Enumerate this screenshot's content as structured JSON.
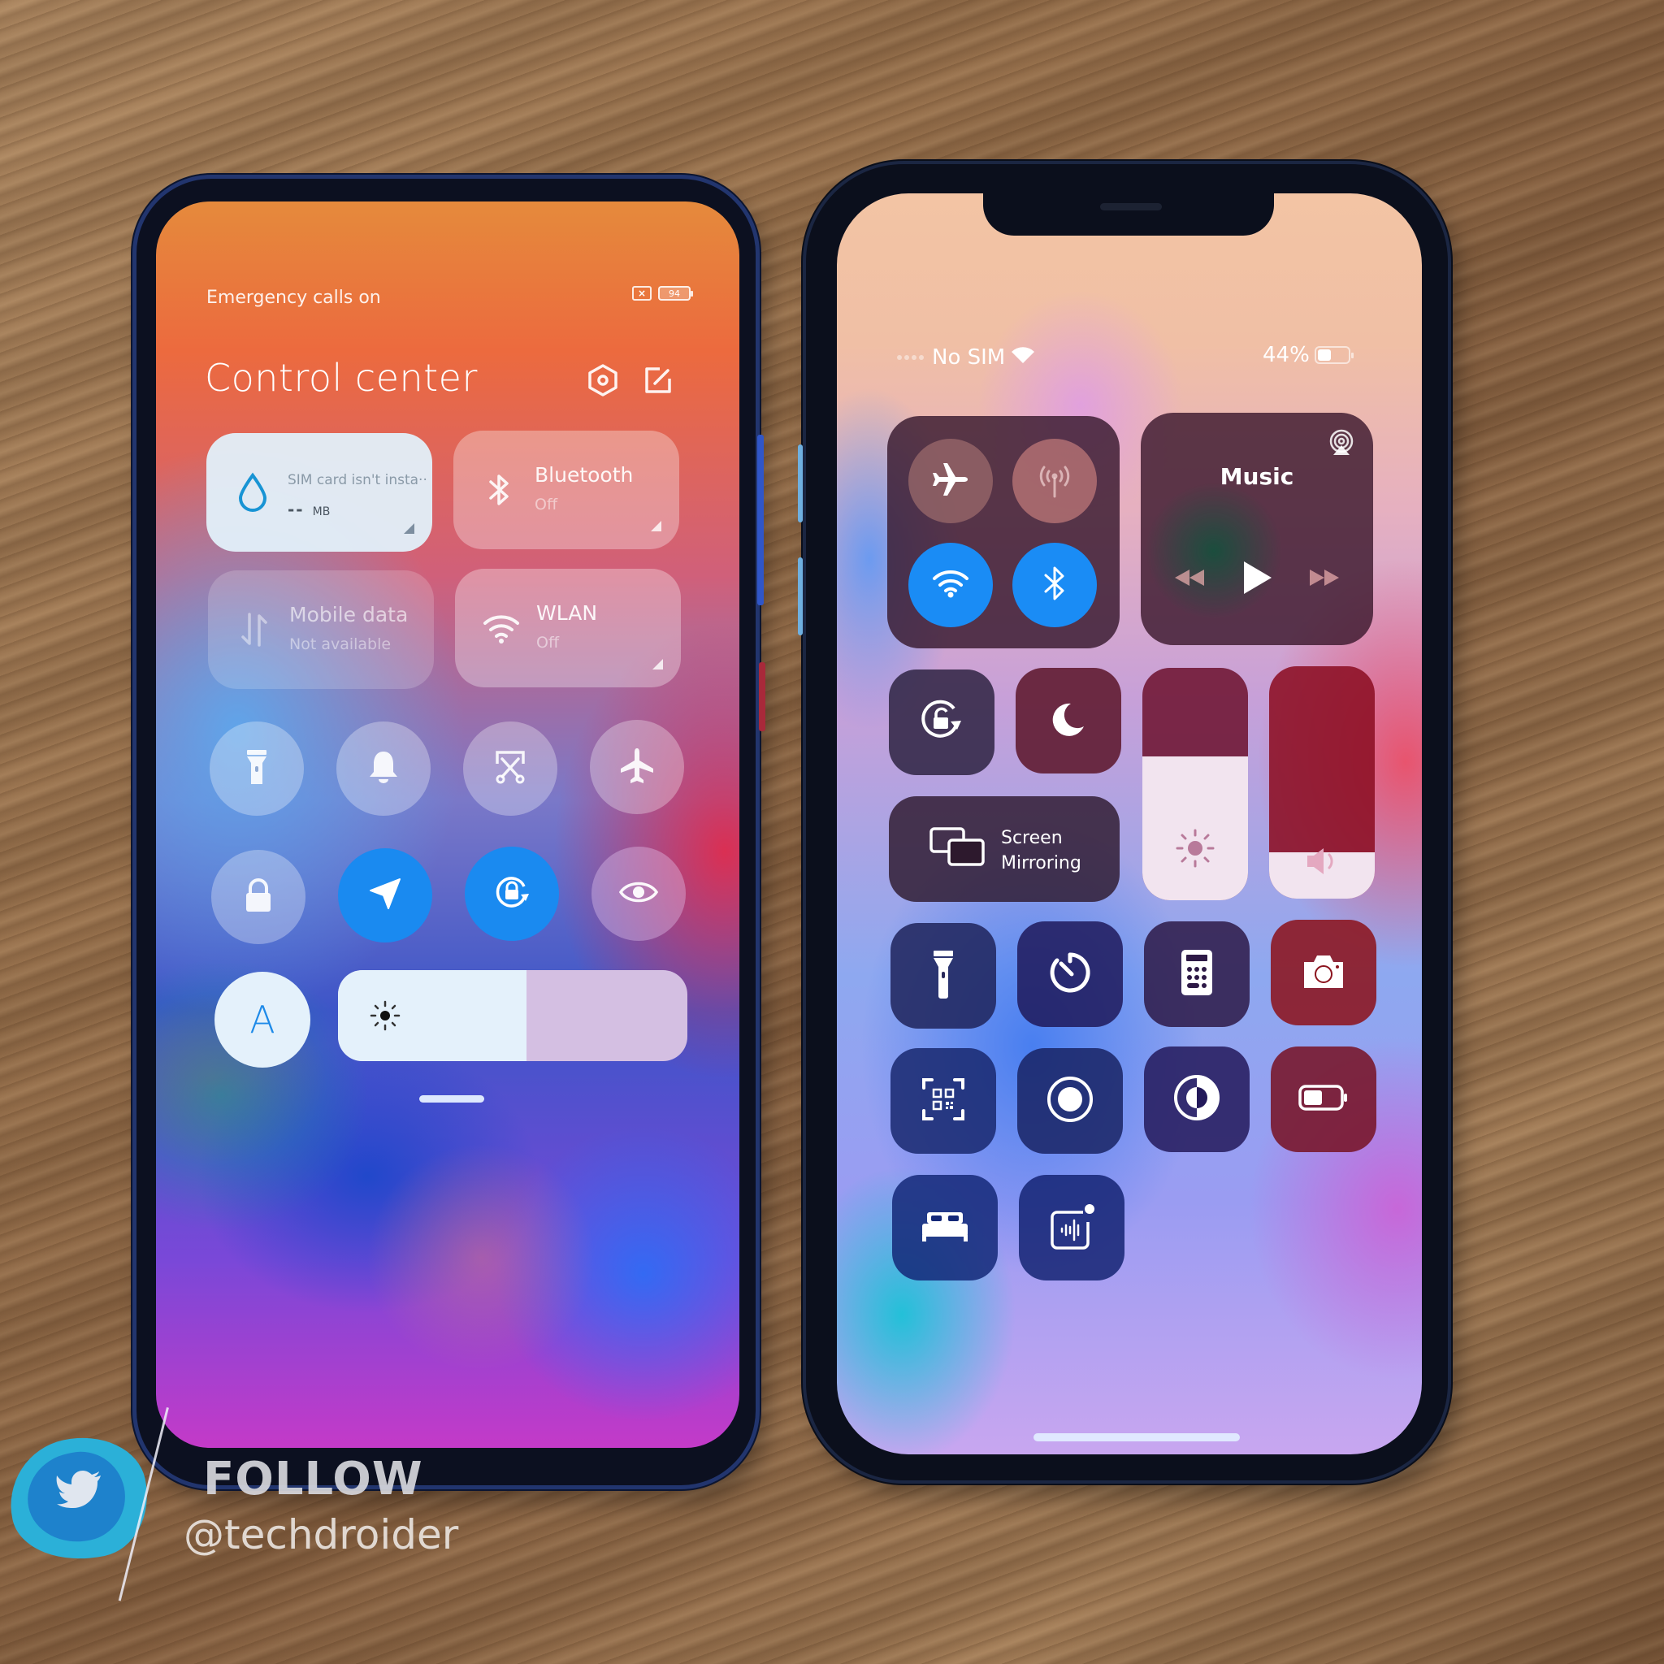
{
  "xiaomi": {
    "status_text": "Emergency calls on",
    "battery_level": "94",
    "sim_icon": "no-sim-icon",
    "title": "Control center",
    "header_icons": [
      "settings-icon",
      "edit-icon"
    ],
    "tiles": [
      {
        "name": "data-usage",
        "icon": "water-drop-icon",
        "label": "SIM card isn't insta··",
        "value_dash": "--",
        "value_unit": "MB",
        "active": true
      },
      {
        "name": "bluetooth",
        "icon": "bluetooth-icon",
        "label": "Bluetooth",
        "sub": "Off",
        "active": false
      },
      {
        "name": "mobile-data",
        "icon": "mobile-data-icon",
        "label": "Mobile data",
        "sub": "Not available",
        "active": false
      },
      {
        "name": "wlan",
        "icon": "wifi-icon",
        "label": "WLAN",
        "sub": "Off",
        "active": false
      }
    ],
    "toggles_row1": [
      {
        "name": "flashlight",
        "icon": "flashlight-icon",
        "on": false
      },
      {
        "name": "ringer",
        "icon": "bell-icon",
        "on": false
      },
      {
        "name": "screenshot",
        "icon": "scissors-icon",
        "on": false
      },
      {
        "name": "airplane-mode",
        "icon": "airplane-icon",
        "on": false
      }
    ],
    "toggles_row2": [
      {
        "name": "lock-screen",
        "icon": "lock-icon",
        "on": false
      },
      {
        "name": "location",
        "icon": "location-arrow-icon",
        "on": true
      },
      {
        "name": "rotation-lock",
        "icon": "rotation-lock-icon",
        "on": true
      },
      {
        "name": "reading-mode",
        "icon": "eye-icon",
        "on": false
      }
    ],
    "auto_brightness_label": "A",
    "brightness_level": 0.54,
    "accent_color": "#1a8af0"
  },
  "iphone": {
    "carrier": "No SIM",
    "battery_percent": "44%",
    "battery_level": 0.44,
    "connectivity": [
      {
        "name": "airplane-mode",
        "icon": "airplane-icon",
        "on": false
      },
      {
        "name": "cellular-data",
        "icon": "antenna-icon",
        "on": false
      },
      {
        "name": "wifi",
        "icon": "wifi-icon",
        "on": true
      },
      {
        "name": "bluetooth",
        "icon": "bluetooth-icon",
        "on": true
      }
    ],
    "music": {
      "title": "Music",
      "airplay_icon": "airplay-audio-icon",
      "controls": [
        "rewind-icon",
        "play-icon",
        "fast-forward-icon"
      ]
    },
    "orientation_lock_icon": "orientation-lock-icon",
    "do_not_disturb_icon": "moon-icon",
    "screen_mirroring": {
      "line1": "Screen",
      "line2": "Mirroring"
    },
    "brightness_level": 0.62,
    "volume_level": 0.2,
    "shortcuts": [
      {
        "name": "flashlight",
        "icon": "flashlight-icon"
      },
      {
        "name": "timer",
        "icon": "timer-icon"
      },
      {
        "name": "calculator",
        "icon": "calculator-icon"
      },
      {
        "name": "camera",
        "icon": "camera-icon"
      },
      {
        "name": "qr-scanner",
        "icon": "qr-code-icon"
      },
      {
        "name": "screen-recording",
        "icon": "record-icon"
      },
      {
        "name": "dark-mode",
        "icon": "dark-mode-icon"
      },
      {
        "name": "low-power-mode",
        "icon": "battery-icon"
      },
      {
        "name": "sleep-mode",
        "icon": "bed-icon"
      },
      {
        "name": "sound-recognition",
        "icon": "sound-recognition-icon"
      }
    ],
    "accent_color": "#1a8cf5"
  },
  "watermark": {
    "follow": "FOLLOW",
    "handle": "@techdroider",
    "icon": "twitter-bird-icon"
  }
}
